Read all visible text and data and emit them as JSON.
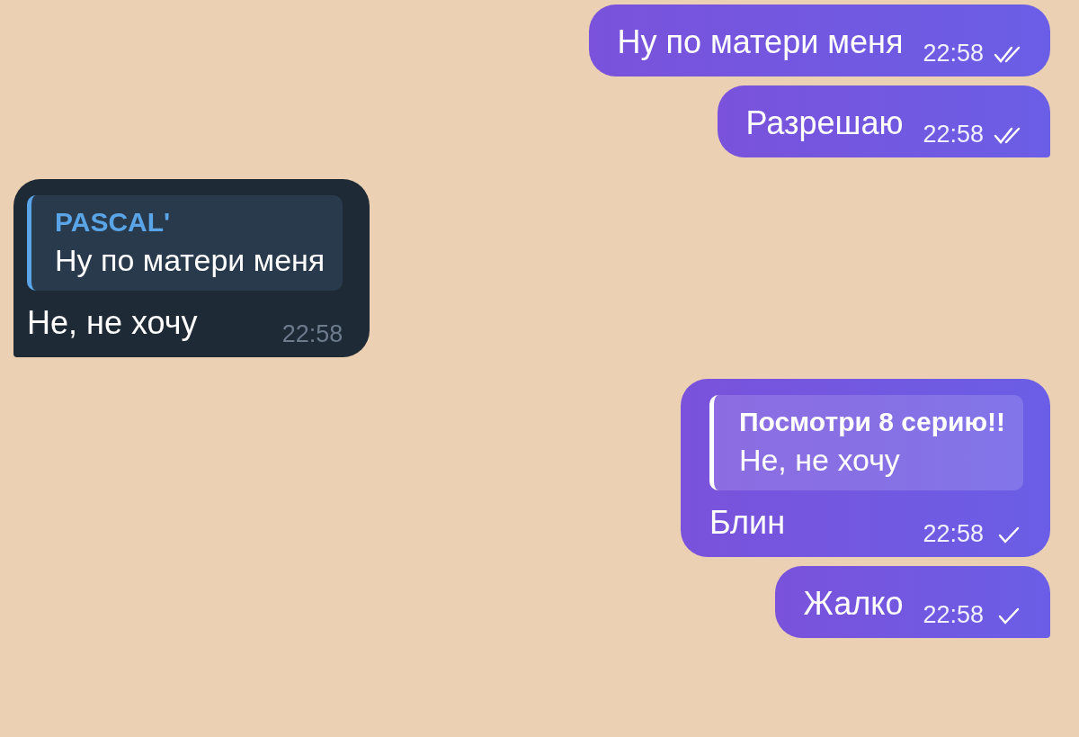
{
  "messages": [
    {
      "kind": "outgoing",
      "text": "Ну по матери меня",
      "time": "22:58",
      "read": true,
      "tail": false
    },
    {
      "kind": "outgoing",
      "text": "Разрешаю",
      "time": "22:58",
      "read": true,
      "tail": true
    },
    {
      "kind": "incoming",
      "reply": {
        "author": "PASCAL'",
        "text": "Ну по матери меня"
      },
      "text": "Не, не хочу",
      "time": "22:58",
      "tail": true
    },
    {
      "kind": "outgoing",
      "reply": {
        "author": "Посмотри 8 серию!!",
        "text": "Не, не хочу"
      },
      "text": "Блин",
      "time": "22:58",
      "read": false,
      "tail": false
    },
    {
      "kind": "outgoing",
      "text": "Жалко",
      "time": "22:58",
      "read": false,
      "tail": true
    }
  ]
}
